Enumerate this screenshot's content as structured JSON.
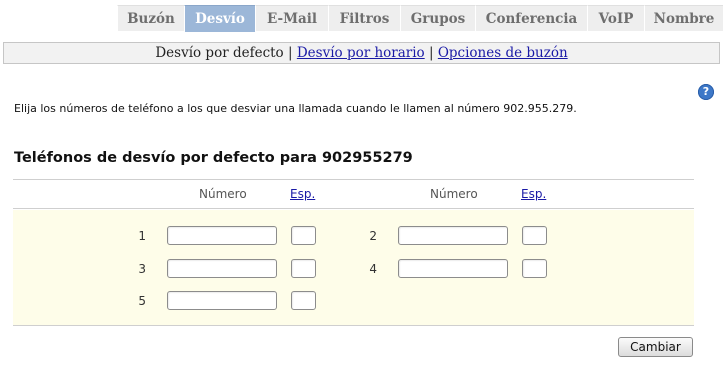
{
  "tabs": [
    {
      "label": "Buzón",
      "active": false
    },
    {
      "label": "Desvío",
      "active": true
    },
    {
      "label": "E-Mail",
      "active": false
    },
    {
      "label": "Filtros",
      "active": false
    },
    {
      "label": "Grupos",
      "active": false
    },
    {
      "label": "Conferencia",
      "active": false
    },
    {
      "label": "VoIP",
      "active": false
    },
    {
      "label": "Nombre",
      "active": false
    }
  ],
  "subnav": {
    "current": "Desvío por defecto",
    "separator": "|",
    "link_schedule": "Desvío por horario",
    "link_mailbox": "Opciones de buzón"
  },
  "help": {
    "glyph": "?",
    "icon": "help-icon"
  },
  "intro_text": "Elija los números de teléfono a los que desviar una llamada cuando le llamen al número 902.955.279.",
  "section_title": "Teléfonos de desvío por defecto para 902955279",
  "table_header": {
    "numero": "Número",
    "esp": "Esp."
  },
  "rows": [
    {
      "index": "1",
      "numero": "",
      "esp": ""
    },
    {
      "index": "2",
      "numero": "",
      "esp": ""
    },
    {
      "index": "3",
      "numero": "",
      "esp": ""
    },
    {
      "index": "4",
      "numero": "",
      "esp": ""
    },
    {
      "index": "5",
      "numero": "",
      "esp": ""
    }
  ],
  "submit_label": "Cambiar",
  "colors": {
    "active_tab": "#9cb7d8",
    "panel_bg": "#fefde9",
    "link": "#1a1aa6"
  }
}
